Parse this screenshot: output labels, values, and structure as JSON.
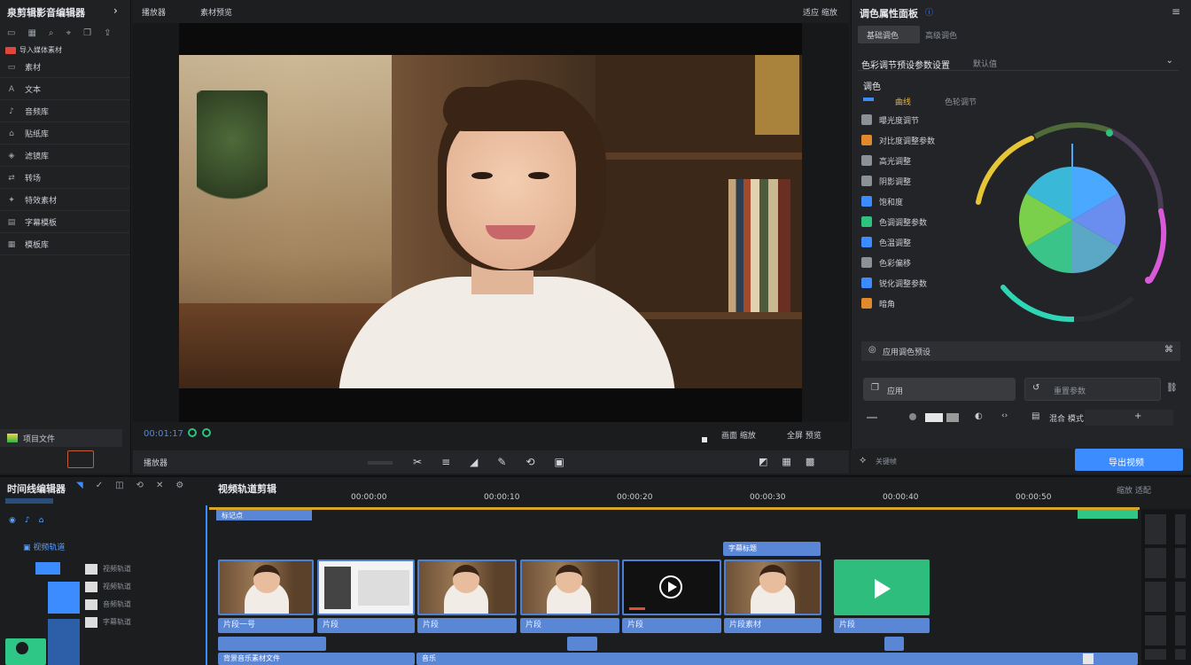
{
  "app": {
    "title": "泉剪辑影音编辑器",
    "left_tabs": [
      "媒体",
      "音频",
      "文本"
    ],
    "import_tag": "导入媒体素材"
  },
  "sidebar": {
    "items": [
      {
        "icon": "folder-icon",
        "label": "素材"
      },
      {
        "icon": "text-icon",
        "label": "文本"
      },
      {
        "icon": "music-icon",
        "label": "音频库"
      },
      {
        "icon": "sticker-icon",
        "label": "贴纸库"
      },
      {
        "icon": "filter-icon",
        "label": "滤镜库"
      },
      {
        "icon": "transition-icon",
        "label": "转场"
      },
      {
        "icon": "effect-icon",
        "label": "特效素材"
      },
      {
        "icon": "caption-icon",
        "label": "字幕模板"
      },
      {
        "icon": "template-icon",
        "label": "模板库"
      }
    ],
    "bottom_label": "项目文件",
    "bottom_icon": "project-icon"
  },
  "viewer": {
    "tab_left": "播放器",
    "tab_mid": "素材预览",
    "top_right": "适应 缩放",
    "timecode": "00:01:17",
    "zoom_label": "画面 缩放",
    "res_label": "全屏 预览",
    "ctrl_label": "播放器"
  },
  "inspector": {
    "title": "调色属性面板",
    "tab_active": "基础调色",
    "tab_other": "高级调色",
    "preset_label": "色彩调节预设参数设置",
    "preset_value": "默认值",
    "section": "调色",
    "sub_active": "曲线",
    "sub_other": "色轮调节",
    "rows": [
      {
        "icon": "exposure-icon",
        "label": "曝光度调节",
        "color": "#8c9097"
      },
      {
        "icon": "contrast-icon",
        "label": "对比度调整参数",
        "color": "#e08a2c"
      },
      {
        "icon": "highlight-icon",
        "label": "高光调整",
        "color": "#8c9097"
      },
      {
        "icon": "shadow-icon",
        "label": "阴影调整",
        "color": "#8c9097"
      },
      {
        "icon": "saturation-icon",
        "label": "饱和度",
        "color": "#3d8cff"
      },
      {
        "icon": "hue-icon",
        "label": "色调调整参数",
        "color": "#2ec27e"
      },
      {
        "icon": "temp-icon",
        "label": "色温调整",
        "color": "#3d8cff"
      },
      {
        "icon": "tint-icon",
        "label": "色彩偏移",
        "color": "#8c9097"
      },
      {
        "icon": "sharpen-icon",
        "label": "锐化调整参数",
        "color": "#3d8cff"
      },
      {
        "icon": "vignette-icon",
        "label": "暗角",
        "color": "#e08a2c"
      }
    ],
    "lut_label": "应用调色预设",
    "btn_apply": "应用",
    "btn_reset": "重置参数",
    "row_mix": "混合 模式",
    "export_label": "导出视频",
    "bottom_left": "关键帧"
  },
  "timeline": {
    "title": "时间线编辑器",
    "track_title": "视频轨道剪辑",
    "ruler": [
      "00:00:00",
      "00:00:10",
      "00:00:20",
      "00:00:30",
      "00:00:40",
      "00:00:50"
    ],
    "right_tools": "缩放 适配",
    "tracks": [
      "视频轨道",
      "视频轨道",
      "音频轨道",
      "字幕轨道"
    ],
    "clips": [
      {
        "kind": "person",
        "label": "片段一号"
      },
      {
        "kind": "card",
        "label": "片段"
      },
      {
        "kind": "person",
        "label": "片段"
      },
      {
        "kind": "person",
        "label": "片段"
      },
      {
        "kind": "play",
        "label": "片段"
      },
      {
        "kind": "person",
        "label": "片段素材"
      },
      {
        "kind": "green",
        "label": "片段"
      }
    ],
    "overlay_clip": "字幕标题",
    "audio_label": "背景音乐素材文件",
    "audio_label2": "音乐",
    "marker_label": "标记点"
  }
}
